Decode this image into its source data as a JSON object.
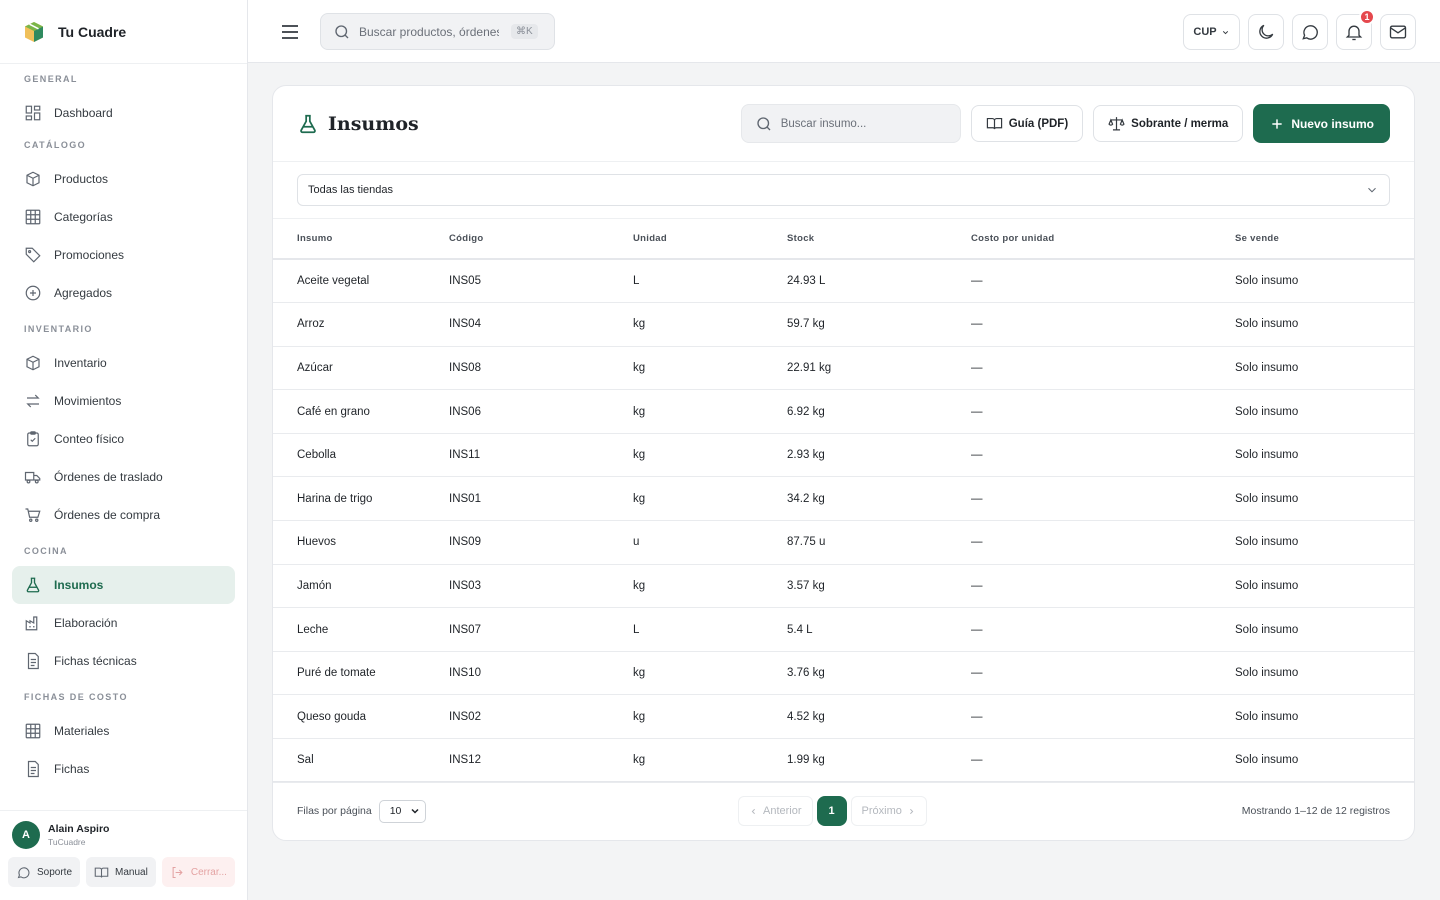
{
  "brand": {
    "name": "Tu Cuadre"
  },
  "sidebar": {
    "sections": [
      {
        "label": "GENERAL",
        "items": [
          {
            "label": "Dashboard",
            "icon": "dashboard-icon"
          }
        ]
      },
      {
        "label": "CATÁLOGO",
        "items": [
          {
            "label": "Productos",
            "icon": "box-icon"
          },
          {
            "label": "Categorías",
            "icon": "grid-icon"
          },
          {
            "label": "Promociones",
            "icon": "tag-icon"
          },
          {
            "label": "Agregados",
            "icon": "plus-circle-icon"
          }
        ]
      },
      {
        "label": "INVENTARIO",
        "items": [
          {
            "label": "Inventario",
            "icon": "box-icon"
          },
          {
            "label": "Movimientos",
            "icon": "arrows-icon"
          },
          {
            "label": "Conteo físico",
            "icon": "clipboard-icon"
          },
          {
            "label": "Órdenes de traslado",
            "icon": "truck-icon"
          },
          {
            "label": "Órdenes de compra",
            "icon": "cart-icon"
          }
        ]
      },
      {
        "label": "COCINA",
        "items": [
          {
            "label": "Insumos",
            "icon": "flask-icon",
            "active": true
          },
          {
            "label": "Elaboración",
            "icon": "factory-icon"
          },
          {
            "label": "Fichas técnicas",
            "icon": "file-icon"
          }
        ]
      },
      {
        "label": "FICHAS DE COSTO",
        "items": [
          {
            "label": "Materiales",
            "icon": "grid-icon"
          },
          {
            "label": "Fichas",
            "icon": "file-icon"
          }
        ]
      }
    ],
    "user": {
      "initial": "A",
      "name": "Alain Aspiro",
      "org": "TuCuadre"
    },
    "footer_buttons": {
      "support": "Soporte",
      "manual": "Manual",
      "logout": "Cerrar..."
    }
  },
  "topbar": {
    "search_placeholder": "Buscar productos, órdenes…",
    "shortcut": "⌘K",
    "currency": "CUP",
    "notification_count": "1"
  },
  "page": {
    "title": "Insumos",
    "search_placeholder": "Buscar insumo...",
    "guide_button": "Guía (PDF)",
    "surplus_button": "Sobrante / merma",
    "new_button": "Nuevo insumo",
    "store_filter": "Todas las tiendas"
  },
  "table": {
    "headers": [
      "Insumo",
      "Código",
      "Unidad",
      "Stock",
      "Costo por unidad",
      "Se vende"
    ],
    "rows": [
      [
        "Aceite vegetal",
        "INS05",
        "L",
        "24.93 L",
        "—",
        "Solo insumo"
      ],
      [
        "Arroz",
        "INS04",
        "kg",
        "59.7 kg",
        "—",
        "Solo insumo"
      ],
      [
        "Azúcar",
        "INS08",
        "kg",
        "22.91 kg",
        "—",
        "Solo insumo"
      ],
      [
        "Café en grano",
        "INS06",
        "kg",
        "6.92 kg",
        "—",
        "Solo insumo"
      ],
      [
        "Cebolla",
        "INS11",
        "kg",
        "2.93 kg",
        "—",
        "Solo insumo"
      ],
      [
        "Harina de trigo",
        "INS01",
        "kg",
        "34.2 kg",
        "—",
        "Solo insumo"
      ],
      [
        "Huevos",
        "INS09",
        "u",
        "87.75 u",
        "—",
        "Solo insumo"
      ],
      [
        "Jamón",
        "INS03",
        "kg",
        "3.57 kg",
        "—",
        "Solo insumo"
      ],
      [
        "Leche",
        "INS07",
        "L",
        "5.4 L",
        "—",
        "Solo insumo"
      ],
      [
        "Puré de tomate",
        "INS10",
        "kg",
        "3.76 kg",
        "—",
        "Solo insumo"
      ],
      [
        "Queso gouda",
        "INS02",
        "kg",
        "4.52 kg",
        "—",
        "Solo insumo"
      ],
      [
        "Sal",
        "INS12",
        "kg",
        "1.99 kg",
        "—",
        "Solo insumo"
      ]
    ]
  },
  "pagination": {
    "rows_label": "Filas por página",
    "rows_value": "10",
    "prev": "Anterior",
    "current": "1",
    "next": "Próximo",
    "showing": "Mostrando 1–12 de 12 registros"
  },
  "colors": {
    "accent": "#1e6b4f",
    "accent_light": "#e6f0ec",
    "badge": "#e5484d"
  }
}
